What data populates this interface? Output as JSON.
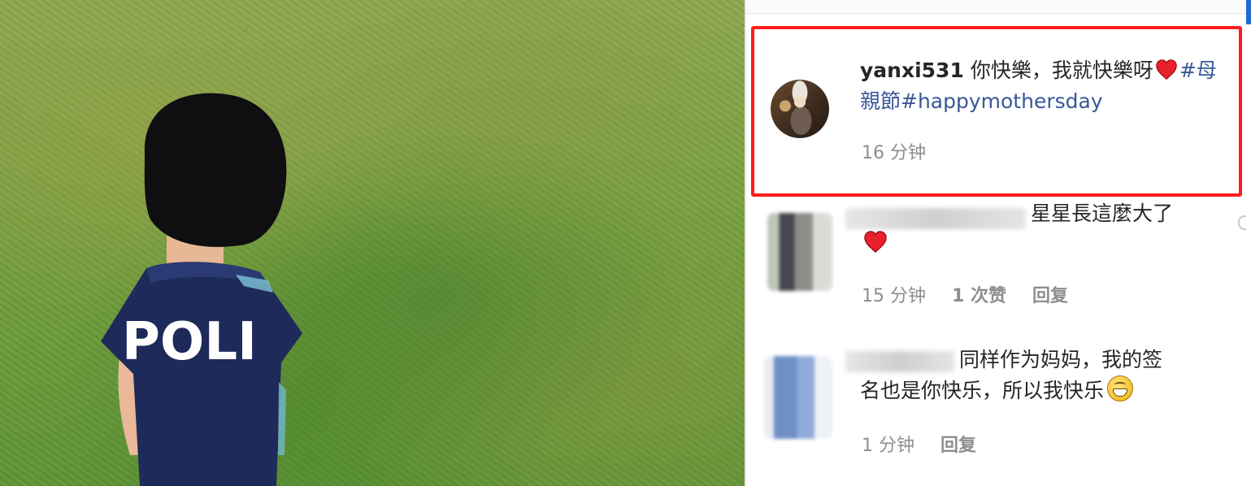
{
  "comments": [
    {
      "username": "yanxi531",
      "text_before": "你快樂，我就快樂呀",
      "hashtag1_part1": "#母",
      "hashtag1_part2": "親節",
      "hashtag2": "#happymothersday",
      "time": "16 分钟"
    },
    {
      "text": "星星長這麼大了",
      "time": "15 分钟",
      "likes": "1 次赞",
      "reply": "回复"
    },
    {
      "text_line1": "同样作为妈妈，我的签",
      "text_line2": "名也是你快乐，所以我快乐",
      "time": "1 分钟",
      "reply": "回复"
    }
  ],
  "photo": {
    "shirt_text": "POLI"
  },
  "colors": {
    "highlight": "#ff1c1c",
    "hashtag": "#385898",
    "heart": "#e8202a",
    "meta": "#8e8e8e"
  },
  "icons": [
    "heart-icon",
    "grin-emoji-icon"
  ]
}
